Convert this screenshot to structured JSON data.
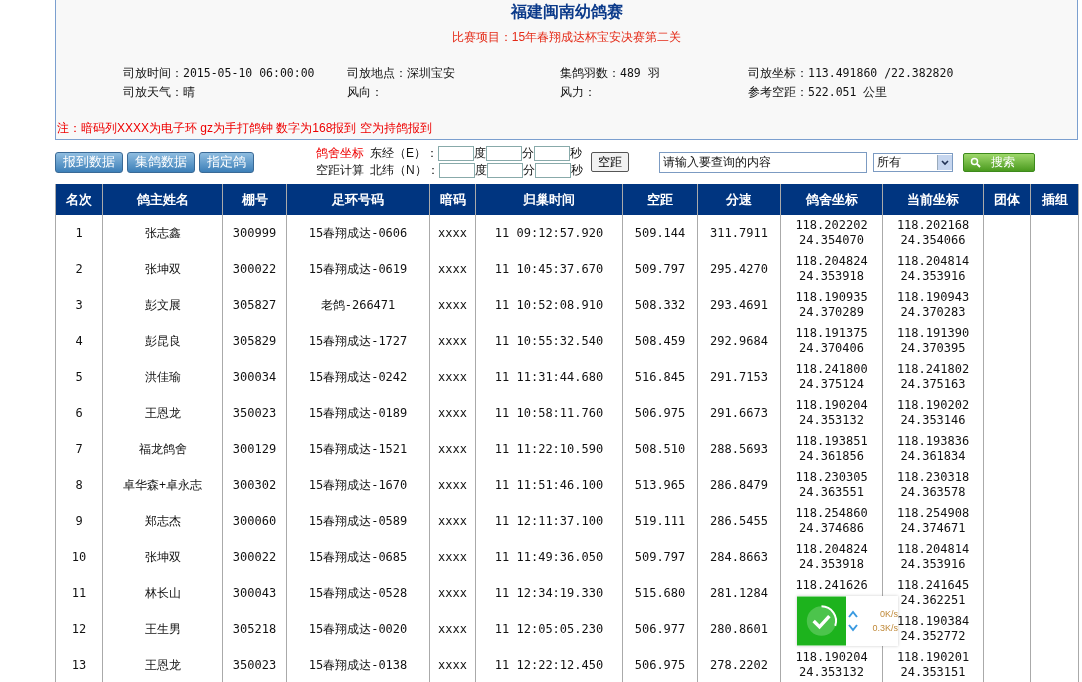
{
  "header": {
    "title": "福建闽南幼鸽赛",
    "subtitle": "比赛项目：15年春翔成达杯宝安决赛第二关",
    "info": [
      "司放时间：2015-05-10 06:00:00",
      "司放地点：深圳宝安",
      "集鸽羽数：489 羽",
      "司放坐标：113.491860 /22.382820",
      "司放天气：晴",
      "风向：",
      "风力：",
      "参考空距：522.051 公里"
    ],
    "note": "注：暗码列XXXX为电子环 gz为手打鸽钟 数字为168报到 空为持鸽报到"
  },
  "toolbar": {
    "buttons": [
      "报到数据",
      "集鸽数据",
      "指定鸽"
    ],
    "coord_title": "鸽舍坐标",
    "coord_subtitle": "空距计算",
    "coord_rows": [
      {
        "label": "东经（E）：",
        "units": [
          "度",
          "分",
          "秒"
        ]
      },
      {
        "label": "北纬（N）：",
        "units": [
          "度",
          "分",
          "秒"
        ]
      }
    ],
    "calc_button": "空距",
    "search": {
      "value": "请输入要查询的内容"
    },
    "filter": "所有",
    "search_button": "搜索"
  },
  "table": {
    "columns": [
      "名次",
      "鸽主姓名",
      "棚号",
      "足环号码",
      "暗码",
      "归巢时间",
      "空距",
      "分速",
      "鸽舍坐标",
      "当前坐标",
      "团体",
      "插组"
    ],
    "rows": [
      {
        "rank": "1",
        "owner": "张志鑫",
        "loft_no": "300999",
        "ring": "15春翔成达-0606",
        "code": "xxxx",
        "time": "11 09:12:57.920",
        "distance": "509.144",
        "speed": "311.7911",
        "loft_coord": [
          "118.202202",
          "24.354070"
        ],
        "current_coord": [
          "118.202168",
          "24.354066"
        ]
      },
      {
        "rank": "2",
        "owner": "张坤双",
        "loft_no": "300022",
        "ring": "15春翔成达-0619",
        "code": "xxxx",
        "time": "11 10:45:37.670",
        "distance": "509.797",
        "speed": "295.4270",
        "loft_coord": [
          "118.204824",
          "24.353918"
        ],
        "current_coord": [
          "118.204814",
          "24.353916"
        ]
      },
      {
        "rank": "3",
        "owner": "彭文展",
        "loft_no": "305827",
        "ring": "老鸽-266471",
        "code": "xxxx",
        "time": "11 10:52:08.910",
        "distance": "508.332",
        "speed": "293.4691",
        "loft_coord": [
          "118.190935",
          "24.370289"
        ],
        "current_coord": [
          "118.190943",
          "24.370283"
        ]
      },
      {
        "rank": "4",
        "owner": "彭昆良",
        "loft_no": "305829",
        "ring": "15春翔成达-1727",
        "code": "xxxx",
        "time": "11 10:55:32.540",
        "distance": "508.459",
        "speed": "292.9684",
        "loft_coord": [
          "118.191375",
          "24.370406"
        ],
        "current_coord": [
          "118.191390",
          "24.370395"
        ]
      },
      {
        "rank": "5",
        "owner": "洪佳瑜",
        "loft_no": "300034",
        "ring": "15春翔成达-0242",
        "code": "xxxx",
        "time": "11 11:31:44.680",
        "distance": "516.845",
        "speed": "291.7153",
        "loft_coord": [
          "118.241800",
          "24.375124"
        ],
        "current_coord": [
          "118.241802",
          "24.375163"
        ]
      },
      {
        "rank": "6",
        "owner": "王恩龙",
        "loft_no": "350023",
        "ring": "15春翔成达-0189",
        "code": "xxxx",
        "time": "11 10:58:11.760",
        "distance": "506.975",
        "speed": "291.6673",
        "loft_coord": [
          "118.190204",
          "24.353132"
        ],
        "current_coord": [
          "118.190202",
          "24.353146"
        ]
      },
      {
        "rank": "7",
        "owner": "福龙鸽舍",
        "loft_no": "300129",
        "ring": "15春翔成达-1521",
        "code": "xxxx",
        "time": "11 11:22:10.590",
        "distance": "508.510",
        "speed": "288.5693",
        "loft_coord": [
          "118.193851",
          "24.361856"
        ],
        "current_coord": [
          "118.193836",
          "24.361834"
        ]
      },
      {
        "rank": "8",
        "owner": "卓华森+卓永志",
        "loft_no": "300302",
        "ring": "15春翔成达-1670",
        "code": "xxxx",
        "time": "11 11:51:46.100",
        "distance": "513.965",
        "speed": "286.8479",
        "loft_coord": [
          "118.230305",
          "24.363551"
        ],
        "current_coord": [
          "118.230318",
          "24.363578"
        ]
      },
      {
        "rank": "9",
        "owner": "郑志杰",
        "loft_no": "300060",
        "ring": "15春翔成达-0589",
        "code": "xxxx",
        "time": "11 12:11:37.100",
        "distance": "519.111",
        "speed": "286.5455",
        "loft_coord": [
          "118.254860",
          "24.374686"
        ],
        "current_coord": [
          "118.254908",
          "24.374671"
        ]
      },
      {
        "rank": "10",
        "owner": "张坤双",
        "loft_no": "300022",
        "ring": "15春翔成达-0685",
        "code": "xxxx",
        "time": "11 11:49:36.050",
        "distance": "509.797",
        "speed": "284.8663",
        "loft_coord": [
          "118.204824",
          "24.353918"
        ],
        "current_coord": [
          "118.204814",
          "24.353916"
        ]
      },
      {
        "rank": "11",
        "owner": "林长山",
        "loft_no": "300043",
        "ring": "15春翔成达-0528",
        "code": "xxxx",
        "time": "11 12:34:19.330",
        "distance": "515.680",
        "speed": "281.1284",
        "loft_coord": [
          "118.241626"
        ],
        "current_coord": [
          "118.241645",
          "24.362251"
        ]
      },
      {
        "rank": "12",
        "owner": "王生男",
        "loft_no": "305218",
        "ring": "15春翔成达-0020",
        "code": "xxxx",
        "time": "11 12:05:05.230",
        "distance": "506.977",
        "speed": "280.8601",
        "current_coord": [
          "118.190384",
          "24.352772"
        ]
      },
      {
        "rank": "13",
        "owner": "王恩龙",
        "loft_no": "350023",
        "ring": "15春翔成达-0138",
        "code": "xxxx",
        "time": "11 12:22:12.450",
        "distance": "506.975",
        "speed": "278.2202",
        "loft_coord": [
          "118.190204",
          "24.353132"
        ],
        "current_coord": [
          "118.190201",
          "24.353151"
        ]
      }
    ]
  },
  "speed_widget": {
    "upload": "0K/s",
    "download": "0.3K/s"
  }
}
